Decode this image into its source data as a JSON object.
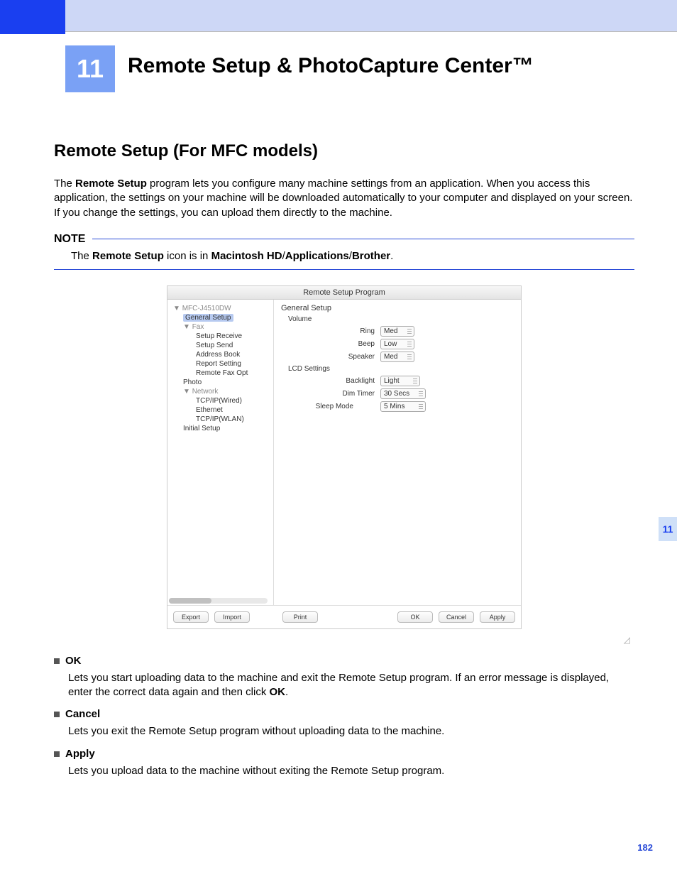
{
  "chapter": {
    "number": "11",
    "title": "Remote Setup & PhotoCapture Center™"
  },
  "sideTab": "11",
  "section": {
    "heading": "Remote Setup (For MFC models)"
  },
  "intro": {
    "pre": "The ",
    "b1": "Remote Setup",
    "post": " program lets you configure many machine settings from an application. When you access this application, the settings on your machine will be downloaded automatically to your computer and displayed on your screen. If you change the settings, you can upload them directly to the machine."
  },
  "note": {
    "label": "NOTE",
    "t1": "The ",
    "b1": "Remote Setup",
    "t2": " icon is in ",
    "b2": "Macintosh HD",
    "sep": "/",
    "b3": "Applications",
    "b4": "Brother",
    "period": "."
  },
  "screenshot": {
    "title": "Remote Setup Program",
    "tree": {
      "root": "MFC-J4510DW",
      "selected": "General Setup",
      "fax": "Fax",
      "faxItems": [
        "Setup Receive",
        "Setup Send",
        "Address Book",
        "Report Setting",
        "Remote Fax Opt"
      ],
      "photo": "Photo",
      "network": "Network",
      "netItems": [
        "TCP/IP(Wired)",
        "Ethernet",
        "TCP/IP(WLAN)"
      ],
      "initial": "Initial Setup"
    },
    "panel": {
      "heading": "General Setup",
      "volume": "Volume",
      "ring": {
        "label": "Ring",
        "value": "Med"
      },
      "beep": {
        "label": "Beep",
        "value": "Low"
      },
      "speaker": {
        "label": "Speaker",
        "value": "Med"
      },
      "lcd": "LCD Settings",
      "backlight": {
        "label": "Backlight",
        "value": "Light"
      },
      "dim": {
        "label": "Dim Timer",
        "value": "30 Secs"
      },
      "sleep": {
        "label": "Sleep Mode",
        "value": "5 Mins"
      }
    },
    "buttons": {
      "export": "Export",
      "import": "Import",
      "print": "Print",
      "ok": "OK",
      "cancel": "Cancel",
      "apply": "Apply"
    }
  },
  "defs": {
    "ok": {
      "title": "OK",
      "t1": "Lets you start uploading data to the machine and exit the Remote Setup program. If an error message is displayed, enter the correct data again and then click ",
      "b1": "OK",
      "t2": "."
    },
    "cancel": {
      "title": "Cancel",
      "body": "Lets you exit the Remote Setup program without uploading data to the machine."
    },
    "apply": {
      "title": "Apply",
      "body": "Lets you upload data to the machine without exiting the Remote Setup program."
    }
  },
  "pageNumber": "182"
}
